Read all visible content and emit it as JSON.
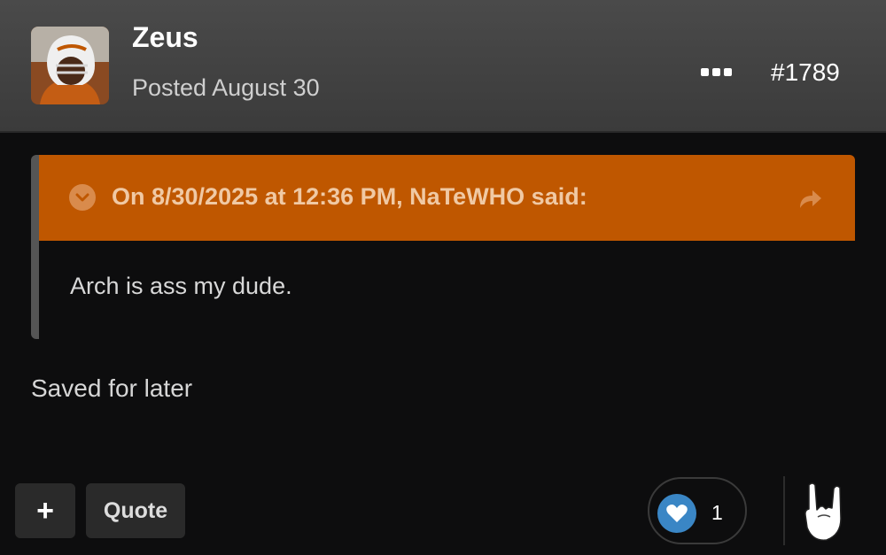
{
  "author": {
    "name": "Zeus",
    "posted": "Posted August 30"
  },
  "post_number": "#1789",
  "quote": {
    "citation": "On 8/30/2025 at 12:36 PM, NaTeWHO said:",
    "text": "Arch is ass my dude."
  },
  "body": "Saved for later",
  "actions": {
    "plus_label": "+",
    "quote_label": "Quote"
  },
  "reaction": {
    "icon": "heart-icon",
    "count": "1"
  },
  "colors": {
    "quote_header": "#bf5700",
    "reaction_heart": "#3a86c5"
  }
}
